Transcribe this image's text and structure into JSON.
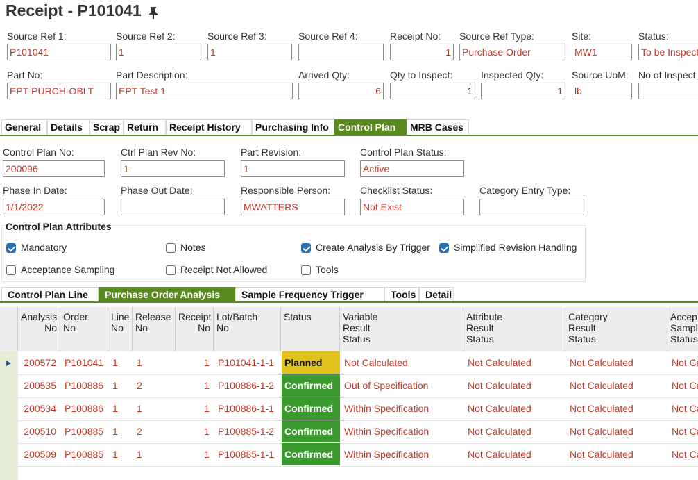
{
  "header": {
    "title": "Receipt - P101041"
  },
  "receipt_fields": [
    {
      "label": "Source Ref 1:",
      "value": "P101041"
    },
    {
      "label": "Source Ref 2:",
      "value": "1"
    },
    {
      "label": "Source Ref 3:",
      "value": "1"
    },
    {
      "label": "Source Ref 4:",
      "value": ""
    },
    {
      "label": "Receipt No:",
      "value": "1"
    },
    {
      "label": "Source Ref Type:",
      "value": "Purchase Order"
    },
    {
      "label": "Site:",
      "value": "MW1"
    },
    {
      "label": "Status:",
      "value": "To be Inspect"
    },
    {
      "label": "Part No:",
      "value": "EPT-PURCH-OBLT"
    },
    {
      "label": "Part Description:",
      "value": "EPT Test 1"
    },
    {
      "label": "Arrived Qty:",
      "value": "6"
    },
    {
      "label": "Qty to Inspect:",
      "value": "1"
    },
    {
      "label": "Inspected Qty:",
      "value": "1"
    },
    {
      "label": "Source UoM:",
      "value": "lb"
    },
    {
      "label": "No of Inspect",
      "value": ""
    }
  ],
  "main_tabs": [
    "General",
    "Details",
    "Scrap",
    "Return",
    "Receipt History",
    "Purchasing Info",
    "Control Plan",
    "MRB Cases"
  ],
  "main_tab_active": "Control Plan",
  "control_plan_fields": [
    {
      "label": "Control Plan No:",
      "value": "200096"
    },
    {
      "label": "Ctrl Plan Rev No:",
      "value": "1"
    },
    {
      "label": "Part Revision:",
      "value": "1"
    },
    {
      "label": "Control Plan Status:",
      "value": "Active"
    },
    {
      "label": "Phase In Date:",
      "value": "1/1/2022"
    },
    {
      "label": "Phase Out Date:",
      "value": ""
    },
    {
      "label": "Responsible Person:",
      "value": "MWATTERS"
    },
    {
      "label": "Checklist Status:",
      "value": "Not Exist"
    },
    {
      "label": "Category Entry Type:",
      "value": ""
    }
  ],
  "attributes": {
    "title": "Control Plan Attributes",
    "items": [
      {
        "label": "Mandatory",
        "checked": true
      },
      {
        "label": "Notes",
        "checked": false
      },
      {
        "label": "Create Analysis By Trigger",
        "checked": true
      },
      {
        "label": "Simplified Revision Handling",
        "checked": true
      },
      {
        "label": "Acceptance Sampling",
        "checked": false
      },
      {
        "label": "Receipt Not Allowed",
        "checked": false
      },
      {
        "label": "Tools",
        "checked": false
      }
    ]
  },
  "sub_tabs": [
    "Control Plan Line",
    "Purchase Order Analysis",
    "Sample Frequency Trigger",
    "Tools",
    "Detail"
  ],
  "sub_tab_active": "Purchase Order Analysis",
  "table": {
    "columns": [
      {
        "l1": "Analysis",
        "l2": "No",
        "l3": ""
      },
      {
        "l1": "Order",
        "l2": "No",
        "l3": ""
      },
      {
        "l1": "Line",
        "l2": "No",
        "l3": ""
      },
      {
        "l1": "Release",
        "l2": "No",
        "l3": ""
      },
      {
        "l1": "Receipt",
        "l2": "No",
        "l3": ""
      },
      {
        "l1": "Lot/Batch",
        "l2": "No",
        "l3": ""
      },
      {
        "l1": "Status",
        "l2": "",
        "l3": ""
      },
      {
        "l1": "Variable",
        "l2": "Result",
        "l3": "Status"
      },
      {
        "l1": "Attribute",
        "l2": "Result",
        "l3": "Status"
      },
      {
        "l1": "Category",
        "l2": "Result",
        "l3": "Status"
      },
      {
        "l1": "Accep",
        "l2": "Sampl",
        "l3": "Status"
      }
    ],
    "rows": [
      {
        "analysis": "200572",
        "order": "P101041",
        "line": "1",
        "release": "1",
        "receipt": "1",
        "lot": "P101041-1-1",
        "status": "Planned",
        "variable": "Not Calculated",
        "attribute": "Not Calculated",
        "category": "Not Calculated",
        "accept": "Not Ca"
      },
      {
        "analysis": "200535",
        "order": "P100886",
        "line": "1",
        "release": "2",
        "receipt": "1",
        "lot": "P100886-1-2",
        "status": "Confirmed",
        "variable": "Out of Specification",
        "attribute": "Not Calculated",
        "category": "Not Calculated",
        "accept": "Not Ca"
      },
      {
        "analysis": "200534",
        "order": "P100886",
        "line": "1",
        "release": "1",
        "receipt": "1",
        "lot": "P100886-1-1",
        "status": "Confirmed",
        "variable": "Within Specification",
        "attribute": "Not Calculated",
        "category": "Not Calculated",
        "accept": "Not Ca"
      },
      {
        "analysis": "200510",
        "order": "P100885",
        "line": "1",
        "release": "2",
        "receipt": "1",
        "lot": "P100885-1-2",
        "status": "Confirmed",
        "variable": "Within Specification",
        "attribute": "Not Calculated",
        "category": "Not Calculated",
        "accept": "Not Ca"
      },
      {
        "analysis": "200509",
        "order": "P100885",
        "line": "1",
        "release": "1",
        "receipt": "1",
        "lot": "P100885-1-1",
        "status": "Confirmed",
        "variable": "Within Specification",
        "attribute": "Not Calculated",
        "category": "Not Calculated",
        "accept": "Not Ca"
      }
    ]
  }
}
